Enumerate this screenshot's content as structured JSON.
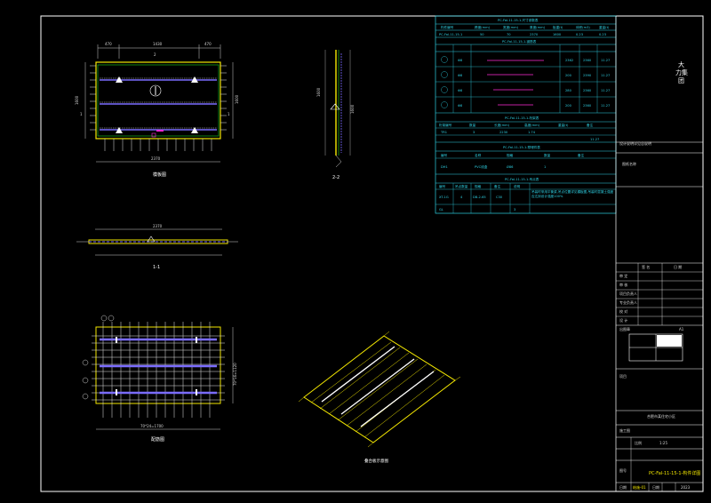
{
  "plan": {
    "total_width": "2370",
    "left_seg": "470",
    "mid_seg": "1430",
    "right_seg": "470",
    "height": "1600",
    "section_mark_left": "1",
    "section_mark_right": "1",
    "title": "模板图"
  },
  "section22": {
    "height": "1600",
    "label": "2-2"
  },
  "section11": {
    "width": "2370",
    "label": "1-1"
  },
  "rebar_plan": {
    "title": "配筋图",
    "bottom_dim": "70*24=1700",
    "left_dim": "70*16=1120"
  },
  "iso": {
    "label": "叠合板示意图"
  },
  "table_main": {
    "header": "PC-Fal-11-15-1-尺寸参数表",
    "cols": [
      "构件编号",
      "跨度(mm)",
      "宽度(mm)",
      "厚度(mm)",
      "板重(t)",
      "体积(m3)",
      "重量(t)"
    ],
    "row": [
      "PC-Fal-11-15-1",
      "50",
      "70",
      "2370",
      "1600",
      "0.23",
      "0.23"
    ]
  },
  "table_rebar": {
    "header": "PC-Fal-11-15-1-钢筋表",
    "rows": [
      {
        "id": "1",
        "spec": "Φ8",
        "len": "2362",
        "n": "2360",
        "w": "11.27"
      },
      {
        "id": "2",
        "spec": "Φ8",
        "len": "200",
        "n": "2390",
        "w": "11.27"
      },
      {
        "id": "3",
        "spec": "Φ8",
        "len": "280",
        "n": "2360",
        "w": "11.27"
      },
      {
        "id": "4",
        "spec": "Φ8",
        "len": "200",
        "n": "2360",
        "w": "11.27"
      }
    ]
  },
  "table_truss": {
    "header": "PC-Fal-11-15-1-桁架表",
    "cols": [
      "桁架编号",
      "数量",
      "长度(mm)",
      "高度(mm)",
      "重量(t)",
      "备注"
    ],
    "row": [
      "TR1",
      "3",
      "2230",
      "1.74",
      "",
      "11.27"
    ]
  },
  "table_embed": {
    "header": "PC-Fal-11-15-1-预埋件表",
    "cols": [
      "编号",
      "名称",
      "规格",
      "数量",
      "备注"
    ],
    "row": [
      "DH1",
      "PVC线盒",
      "Ø86",
      "1",
      ""
    ]
  },
  "table_lift": {
    "header": "PC-Fal-11-15-1-吊点表",
    "cols": [
      "编号",
      "吊点数量",
      "规格",
      "备注",
      "说明"
    ],
    "row": [
      "XT-1G",
      "4",
      "DB-2-65",
      "C30",
      "吊装时采用平衡梁,吊点位置详见模板图,吊装时混凝土强度应达到设计强度100%"
    ],
    "row2": [
      "GL",
      "",
      "",
      "3",
      ""
    ]
  },
  "title_block": {
    "company": "大力集团",
    "project_note": "设计说明详见总说明",
    "drawing_type": "图纸名称",
    "sign_labels": [
      "审 定",
      "审 核",
      "项目负责人",
      "专业负责人",
      "校 对",
      "设 计",
      "制 图"
    ],
    "col_heads": [
      "签 名",
      "日 期"
    ],
    "stamp": "出图章",
    "project": "项目",
    "project_name": "合肥市某住宅小区",
    "stage": "施工图",
    "drawing_name": "PC-Fal-11-15-1-构件详图",
    "scale_label": "比例",
    "scale": "1:25",
    "sheet_label": "图号",
    "sheet_no": "结施-01",
    "date_label": "日期",
    "date": "2023",
    "version": "A1"
  }
}
